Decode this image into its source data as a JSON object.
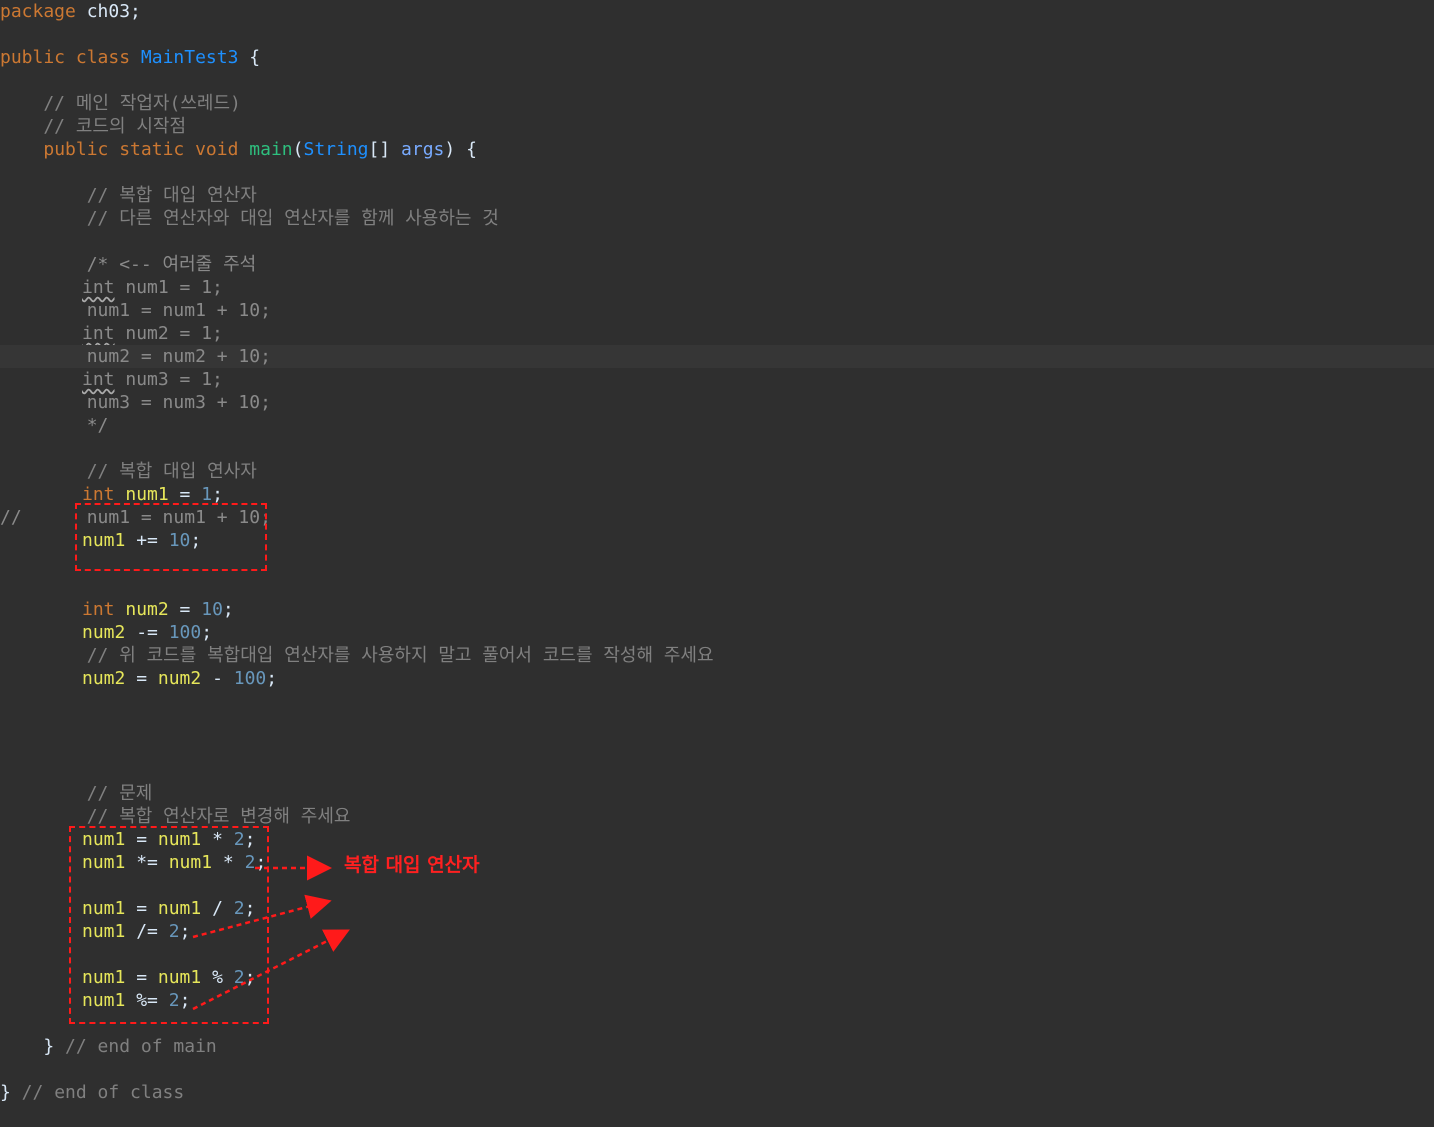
{
  "code": {
    "l1_kw": "package",
    "l1_rest": " ch03;",
    "l3_kw": "public class",
    "l3_cls": "MainTest3",
    "l3_rest": " {",
    "l5": "    // 메인 작업자(쓰레드)",
    "l6": "    // 코드의 시작점",
    "l7_indent": "    ",
    "l7_kw": "public static void",
    "l7_sp": " ",
    "l7_mth": "main",
    "l7_p1": "(",
    "l7_str": "String",
    "l7_p2": "[] ",
    "l7_args": "args",
    "l7_p3": ") {",
    "l9": "        // 복합 대입 연산자",
    "l10": "        // 다른 연산자와 대입 연산자를 함께 사용하는 것",
    "l12": "        /* <-- 여러줄 주석",
    "l13_int": "int",
    "l13_rest": " num1 = 1;",
    "l14": "        num1 = num1 + 10;",
    "l15_int": "int",
    "l15_rest": " num2 = 1;",
    "l16": "        num2 = num2 + 10;",
    "l17_int": "int",
    "l17_rest": " num3 = 1;",
    "l18": "        num3 = num3 + 10;",
    "l19": "        */",
    "l21": "        // 복합 대입 연사자",
    "l22_int": "int",
    "l22_var": "num1",
    "l22_eq": " = ",
    "l22_num": "1",
    "l22_end": ";",
    "l23": "//      num1 = num1 + 10;",
    "l24_var": "num1",
    "l24_op": " += ",
    "l24_num": "10",
    "l24_end": ";",
    "l27_int": "int",
    "l27_var": "num2",
    "l27_eq": " = ",
    "l27_num": "10",
    "l27_end": ";",
    "l28_var": "num2",
    "l28_op": " -= ",
    "l28_num": "100",
    "l28_end": ";",
    "l29": "        // 위 코드를 복합대입 연산자를 사용하지 말고 풀어서 코드를 작성해 주세요",
    "l30_var1": "num2",
    "l30_eq": " = ",
    "l30_var2": "num2",
    "l30_op": " - ",
    "l30_num": "100",
    "l30_end": ";",
    "l35": "        // 문제",
    "l36": "        // 복합 연산자로 변경해 주세요",
    "l37_v1": "num1",
    "l37_eq": " = ",
    "l37_v2": "num1",
    "l37_op": " * ",
    "l37_num": "2",
    "l37_end": ";",
    "l38_v1": "num1",
    "l38_op1": " *= ",
    "l38_v2": "num1",
    "l38_op2": " * ",
    "l38_num": "2",
    "l38_end": ";",
    "l40_v1": "num1",
    "l40_eq": " = ",
    "l40_v2": "num1",
    "l40_op": " / ",
    "l40_num": "2",
    "l40_end": ";",
    "l41_v1": "num1",
    "l41_op": " /= ",
    "l41_num": "2",
    "l41_end": ";",
    "l43_v1": "num1",
    "l43_eq": " = ",
    "l43_v2": "num1",
    "l43_op": " % ",
    "l43_num": "2",
    "l43_end": ";",
    "l44_v1": "num1",
    "l44_op": " %= ",
    "l44_num": "2",
    "l44_end": ";",
    "l46_brace": "    }",
    "l46_cm": " // end of main",
    "l48_brace": "}",
    "l48_cm": " // end of class"
  },
  "annotation": {
    "label": "복합 대입 연산자",
    "color": "#ff1a1a"
  }
}
